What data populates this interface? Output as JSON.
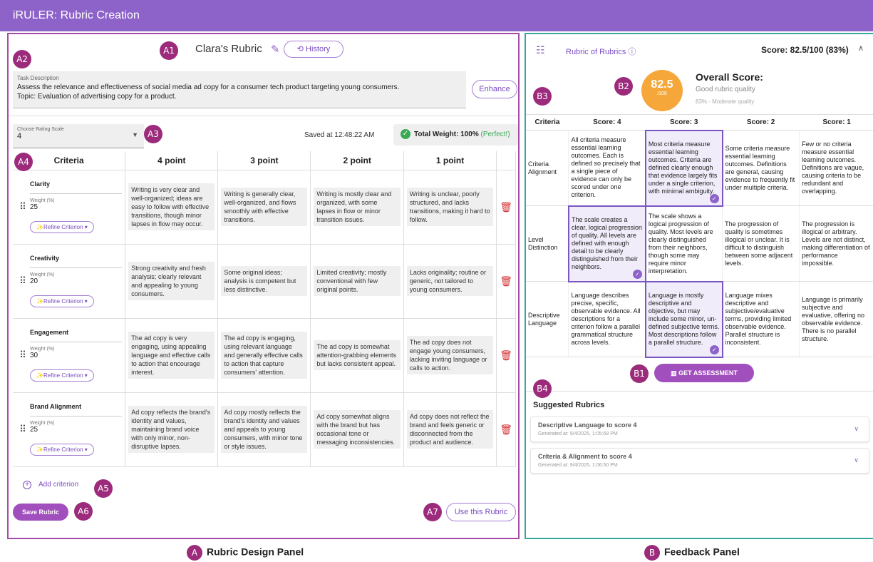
{
  "app_title": "iRULER: Rubric Creation",
  "badges": {
    "a": "A",
    "a1": "A1",
    "a2": "A2",
    "a3": "A3",
    "a4": "A4",
    "a5": "A5",
    "a6": "A6",
    "a7": "A7",
    "b": "B",
    "b1": "B1",
    "b2": "B2",
    "b3": "B3",
    "b4": "B4"
  },
  "rubric": {
    "name": "Clara's Rubric",
    "history_label": "History",
    "enhance_label": "Enhance",
    "task_label": "Task Description",
    "task_line1": "Assess the relevance and effectiveness of social media ad copy for a consumer tech product targeting young consumers.",
    "task_line2": "Topic: Evaluation of advertising copy for a product.",
    "scale_label": "Choose Rating Scale",
    "scale_value": "4",
    "saved_text": "Saved at 12:48:22 AM",
    "total_weight": "Total Weight: 100%",
    "perfect": "(Perfect!)",
    "headers": [
      "Criteria",
      "4 point",
      "3 point",
      "2 point",
      "1 point"
    ],
    "weight_label": "Weight (%)",
    "refine_label": "Refine Criterion",
    "criteria": [
      {
        "name": "Clarity",
        "weight": "25",
        "p4": "Writing is very clear and well-organized; ideas are easy to follow with effective transitions, though minor lapses in flow may occur.",
        "p3": "Writing is generally clear, well-organized, and flows smoothly with effective transitions.",
        "p2": "Writing is mostly clear and organized, with some lapses in flow or minor transition issues.",
        "p1": "Writing is unclear, poorly structured, and lacks transitions, making it hard to follow."
      },
      {
        "name": "Creativity",
        "weight": "20",
        "p4": "Strong creativity and fresh analysis; clearly relevant and appealing to young consumers.",
        "p3": "Some original ideas; analysis is competent but less distinctive.",
        "p2": "Limited creativity; mostly conventional with few original points.",
        "p1": "Lacks originality; routine or generic, not tailored to young consumers."
      },
      {
        "name": "Engagement",
        "weight": "30",
        "p4": "The ad copy is very engaging, using appealing language and effective calls to action that encourage interest.",
        "p3": "The ad copy is engaging, using relevant language and generally effective calls to action that capture consumers' attention.",
        "p2": "The ad copy is somewhat attention-grabbing elements but lacks consistent appeal.",
        "p1": "The ad copy does not engage young consumers, lacking inviting language or calls to action."
      },
      {
        "name": "Brand Alignment",
        "weight": "25",
        "p4": "Ad copy reflects the brand's identity and values, maintaining brand voice with only minor, non-disruptive lapses.",
        "p3": "Ad copy mostly reflects the brand's identity and values and appeals to young consumers, with minor tone or style issues.",
        "p2": "Ad copy somewhat aligns with the brand but has occasional tone or messaging inconsistencies.",
        "p1": "Ad copy does not reflect the brand and feels generic or disconnected from the product and audience."
      }
    ],
    "add_criterion": "Add criterion",
    "save_label": "Save Rubric",
    "use_label": "Use this Rubric"
  },
  "feedback": {
    "title": "Rubric of Rubrics",
    "score_text": "Score: 82.5/100 (83%)",
    "circle_value": "82.5",
    "circle_max": "/100",
    "overall_title": "Overall Score:",
    "overall_sub": "Good rubric quality",
    "overall_sub2": "83% - Moderate quality",
    "headers": [
      "Criteria",
      "Score: 4",
      "Score: 3",
      "Score: 2",
      "Score: 1"
    ],
    "rows": [
      {
        "name": "Criteria Alignment",
        "s4": "All criteria measure essential learning outcomes. Each is defined so precisely that a single piece of evidence can only be scored under one criterion.",
        "s3": "Most criteria measure essential learning outcomes. Criteria are defined clearly enough that evidence largely fits under a single criterion, with minimal ambiguity.",
        "s2": "Some criteria measure essential learning outcomes. Definitions are general, causing evidence to frequently fit under multiple criteria.",
        "s1": "Few or no criteria measure essential learning outcomes. Definitions are vague, causing criteria to be redundant and overlapping."
      },
      {
        "name": "Level Distinction",
        "s4": "The scale creates a clear, logical progression of quality. All levels are defined with enough detail to be clearly distinguished from their neighbors.",
        "s3": "The scale shows a logical progression of quality. Most levels are clearly distinguished from their neighbors, though some may require minor interpretation.",
        "s2": "The progression of quality is sometimes illogical or unclear. It is difficult to distinguish between some adjacent levels.",
        "s1": "The progression is illogical or arbitrary. Levels are not distinct, making differentiation of performance impossible."
      },
      {
        "name": "Descriptive Language",
        "s4": "Language describes precise, specific, observable evidence. All descriptions for a criterion follow a parallel grammatical structure across levels.",
        "s3": "Language is mostly descriptive and objective, but may include some minor, un-defined subjective terms. Most descriptions follow a parallel structure.",
        "s2": "Language mixes descriptive and subjective/evaluative terms, providing limited observable evidence. Parallel structure is inconsistent.",
        "s1": "Language is primarily subjective and evaluative, offering no observable evidence. There is no parallel structure."
      }
    ],
    "assess_label": "GET ASSESSMENT",
    "suggested_title": "Suggested Rubrics",
    "suggestions": [
      {
        "name": "Descriptive Language to score 4",
        "date": "Generated at: 9/4/2025, 1:05:58 PM"
      },
      {
        "name": "Criteria & Alignment to score 4",
        "date": "Generated at: 9/4/2025, 1:06:50 PM"
      }
    ]
  },
  "panel_labels": {
    "a": "Rubric Design Panel",
    "b": "Feedback Panel"
  },
  "colors": {
    "topbar": "#8e63c9",
    "panel_a_border": "#a44ba6",
    "panel_b_border": "#3aa7a0",
    "badge": "#9c2b7c",
    "score_circle": "#f6a73a"
  }
}
